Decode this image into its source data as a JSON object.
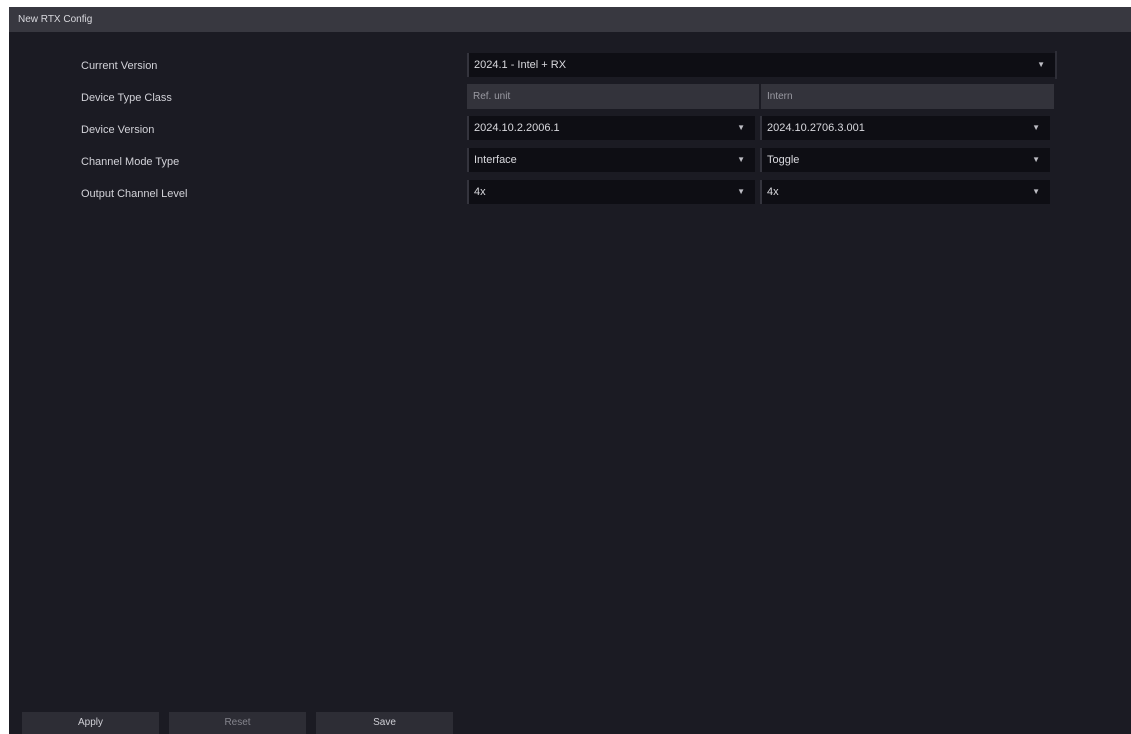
{
  "window": {
    "title": "New RTX Config"
  },
  "rows": [
    {
      "label": "Current Version",
      "value": "2024.1 - Intel + RX"
    },
    {
      "label": "Device Type Class",
      "left_header": "Ref. unit",
      "right_header": "Intern"
    },
    {
      "label": "Device Version",
      "left_value": "2024.10.2.2006.1",
      "right_value": "2024.10.2706.3.001"
    },
    {
      "label": "Channel Mode Type",
      "left_value": "Interface",
      "right_value": "Toggle"
    },
    {
      "label": "Output Channel Level",
      "left_value": "4x",
      "right_value": "4x"
    }
  ],
  "buttons": {
    "apply": "Apply",
    "reset": "Reset",
    "save": "Save"
  },
  "icons": {
    "dropdown": "chevron-down-icon"
  }
}
